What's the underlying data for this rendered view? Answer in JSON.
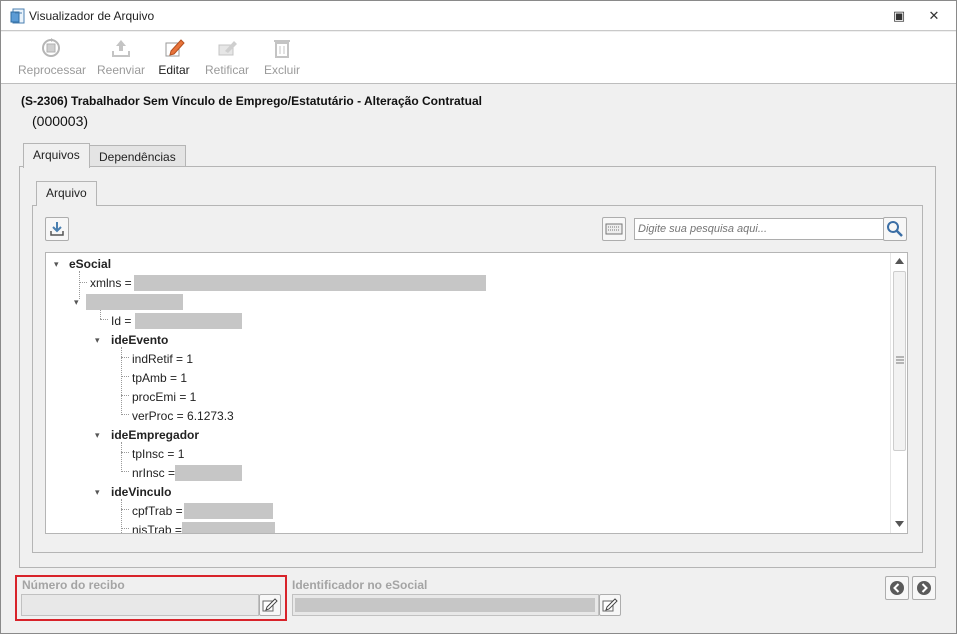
{
  "window": {
    "title": "Visualizador de Arquivo",
    "restore_glyph": "▣",
    "close_glyph": "✕"
  },
  "toolbar": [
    {
      "label": "Reprocessar",
      "icon": "reprocess-icon",
      "enabled": false
    },
    {
      "label": "Reenviar",
      "icon": "upload-icon",
      "enabled": false
    },
    {
      "label": "Editar",
      "icon": "edit-icon",
      "enabled": true
    },
    {
      "label": "Retificar",
      "icon": "rectify-icon",
      "enabled": false
    },
    {
      "label": "Excluir",
      "icon": "trash-icon",
      "enabled": false
    }
  ],
  "header": {
    "event_title": "(S-2306) Trabalhador Sem Vínculo de Emprego/Estatutário - Alteração Contratual",
    "event_code": "(000003)"
  },
  "tabs": {
    "arquivos": "Arquivos",
    "dependencias": "Dependências",
    "arquivo": "Arquivo"
  },
  "search": {
    "placeholder": "Digite sua pesquisa aqui..."
  },
  "tree": {
    "esocial": "eSocial",
    "xmlns": "xmlns =",
    "id": "Id =",
    "ideEvento": "ideEvento",
    "indRetif": "indRetif = 1",
    "tpAmb": "tpAmb = 1",
    "procEmi": "procEmi = 1",
    "verProc": "verProc = 6.1273.3",
    "ideEmpregador": "ideEmpregador",
    "tpInsc": "tpInsc = 1",
    "nrInsc": "nrInsc =",
    "ideVinculo": "ideVinculo",
    "cpfTrab": "cpfTrab =",
    "nisTrab": "nisTrab ="
  },
  "footer": {
    "recibo_label": "Número do recibo",
    "recibo_value": "",
    "identificador_label": "Identificador no eSocial"
  },
  "colors": {
    "highlight": "#d8232a",
    "redaction": "#c6c6c6"
  }
}
